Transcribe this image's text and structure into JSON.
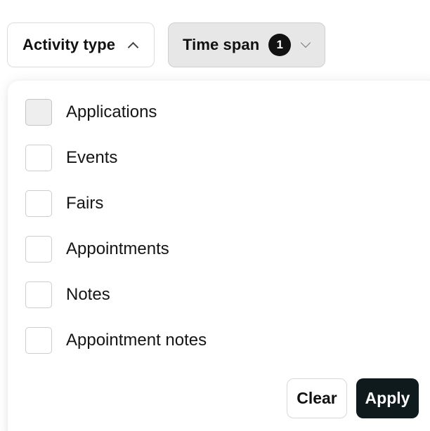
{
  "filters": {
    "activity_type": {
      "label": "Activity type",
      "expanded": true
    },
    "time_span": {
      "label": "Time span",
      "count": "1",
      "expanded": false
    }
  },
  "dropdown": {
    "options": [
      {
        "label": "Applications",
        "checked": false
      },
      {
        "label": "Events",
        "checked": false
      },
      {
        "label": "Fairs",
        "checked": false
      },
      {
        "label": "Appointments",
        "checked": false
      },
      {
        "label": "Notes",
        "checked": false
      },
      {
        "label": "Appointment notes",
        "checked": false
      }
    ],
    "clear_label": "Clear",
    "apply_label": "Apply"
  },
  "colors": {
    "apply_bg": "#0e1a1c",
    "badge_bg": "#111111",
    "time_span_bg": "#e7e7e7"
  },
  "icons": {
    "activity_chevron": "chevron-up-icon",
    "time_span_chevron": "chevron-down-icon"
  }
}
